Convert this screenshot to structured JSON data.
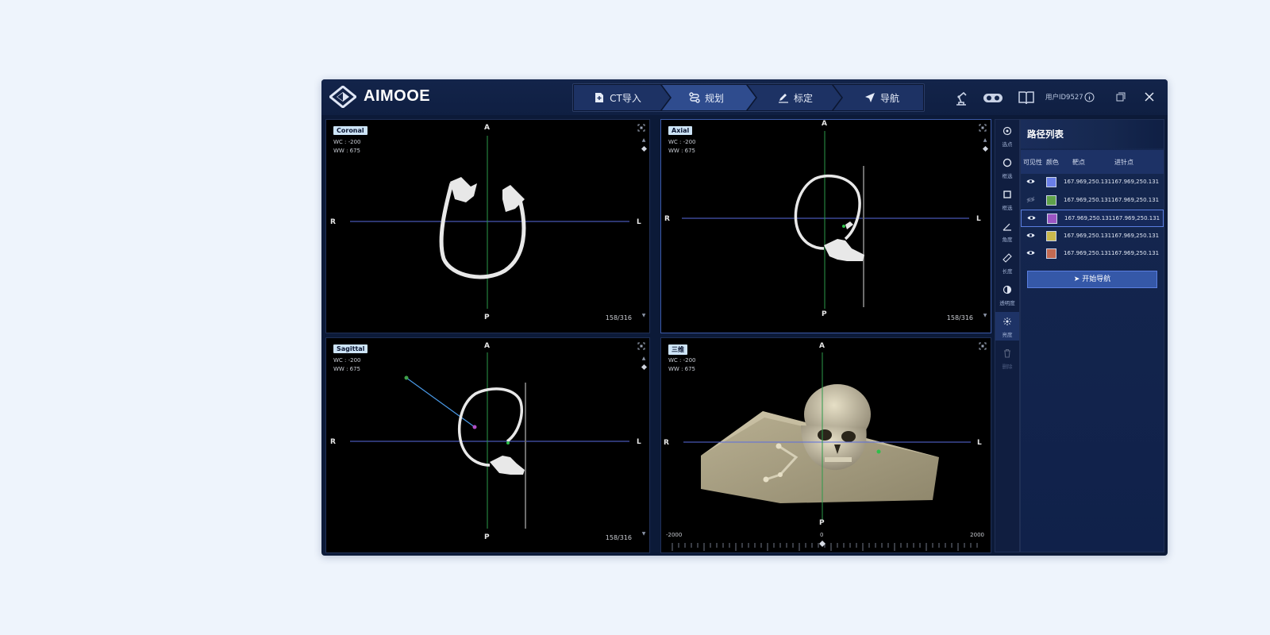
{
  "app": {
    "brand": "AIMOOE",
    "user": "用户ID9527"
  },
  "steps": [
    {
      "label": "CT导入",
      "icon": "file-plus-icon"
    },
    {
      "label": "规划",
      "icon": "route-icon",
      "active": true
    },
    {
      "label": "标定",
      "icon": "pencil-icon"
    },
    {
      "label": "导航",
      "icon": "navigation-arrow-icon"
    }
  ],
  "views": {
    "coronal": {
      "label": "Coronal",
      "wc": "WC : -200",
      "ww": "WW : 675",
      "top": "A",
      "bottom": "P",
      "left": "R",
      "right": "L",
      "slice": "158/316"
    },
    "axial": {
      "label": "Axial",
      "wc": "WC : -200",
      "ww": "WW : 675",
      "top": "A",
      "bottom": "P",
      "left": "R",
      "right": "L",
      "slice": "158/316"
    },
    "sagittal": {
      "label": "Sagittal",
      "wc": "WC : -200",
      "ww": "WW : 675",
      "top": "A",
      "bottom": "P",
      "left": "R",
      "right": "L",
      "slice": "158/316"
    },
    "three_d": {
      "label": "三维",
      "wc": "WC : -200",
      "ww": "WW : 675",
      "top": "A",
      "bottom": "P",
      "left": "R",
      "right": "L",
      "ruler_min": "-2000",
      "ruler_mid": "0",
      "ruler_max": "2000"
    }
  },
  "tools": [
    {
      "label": "选点",
      "icon": "target-point-icon"
    },
    {
      "label": "框选",
      "icon": "circle-select-icon"
    },
    {
      "label": "框选",
      "icon": "square-select-icon"
    },
    {
      "label": "角度",
      "icon": "angle-icon"
    },
    {
      "label": "长度",
      "icon": "ruler-icon"
    },
    {
      "label": "透明度",
      "icon": "contrast-icon"
    },
    {
      "label": "亮度",
      "icon": "brightness-icon",
      "active": true
    },
    {
      "label": "删除",
      "icon": "trash-icon",
      "disabled": true
    }
  ],
  "path_panel": {
    "title": "路径列表",
    "columns": [
      "可见性",
      "颜色",
      "靶点",
      "进针点"
    ],
    "rows": [
      {
        "visible": true,
        "color": "#6a7fe8",
        "target": "167.969,250.131",
        "entry": "167.969,250.131"
      },
      {
        "visible": false,
        "color": "#5fa24a",
        "target": "167.969,250.131",
        "entry": "167.969,250.131"
      },
      {
        "visible": true,
        "color": "#9b55c4",
        "target": "167.969,250.131",
        "entry": "167.969,250.131",
        "selected": true
      },
      {
        "visible": true,
        "color": "#c9b84d",
        "target": "167.969,250.131",
        "entry": "167.969,250.131"
      },
      {
        "visible": true,
        "color": "#c26a52",
        "target": "167.969,250.131",
        "entry": "167.969,250.131"
      }
    ],
    "nav_button": "开始导航"
  }
}
